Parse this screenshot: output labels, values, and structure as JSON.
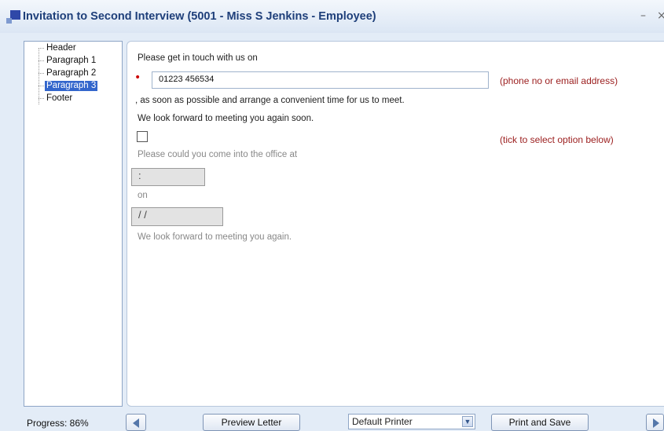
{
  "window": {
    "title": "Invitation to Second Interview (5001 - Miss S Jenkins - Employee)",
    "minimize": "–",
    "close": "×"
  },
  "tree": {
    "items": [
      {
        "label": "Header",
        "selected": false
      },
      {
        "label": "Paragraph 1",
        "selected": false
      },
      {
        "label": "Paragraph 2",
        "selected": false
      },
      {
        "label": "Paragraph 3",
        "selected": true
      },
      {
        "label": "Footer",
        "selected": false
      }
    ]
  },
  "form": {
    "intro": "Please get in touch with us on",
    "contact_value": "01223 456534",
    "contact_hint": "(phone no or email address)",
    "asap_text": ", as soon as possible and arrange a convenient time for us to meet.",
    "look_forward_soon": "We look forward to meeting you again soon.",
    "option_checked": false,
    "option_hint": "(tick to select option below)",
    "office_prompt": "Please could you come into the office at",
    "time_value": ":",
    "on_label": "on",
    "date_value": "/ /",
    "look_forward": "We look forward to meeting you again."
  },
  "footer": {
    "progress": "Progress: 86%",
    "progress_value": 0.86,
    "preview_label": "Preview Letter",
    "printer_selected": "Default Printer",
    "print_save_label": "Print and Save"
  },
  "colors": {
    "accent": "#3366cc",
    "title": "#1e3f7a",
    "hint_red": "#9c2020",
    "background": "#e3ecf7"
  }
}
